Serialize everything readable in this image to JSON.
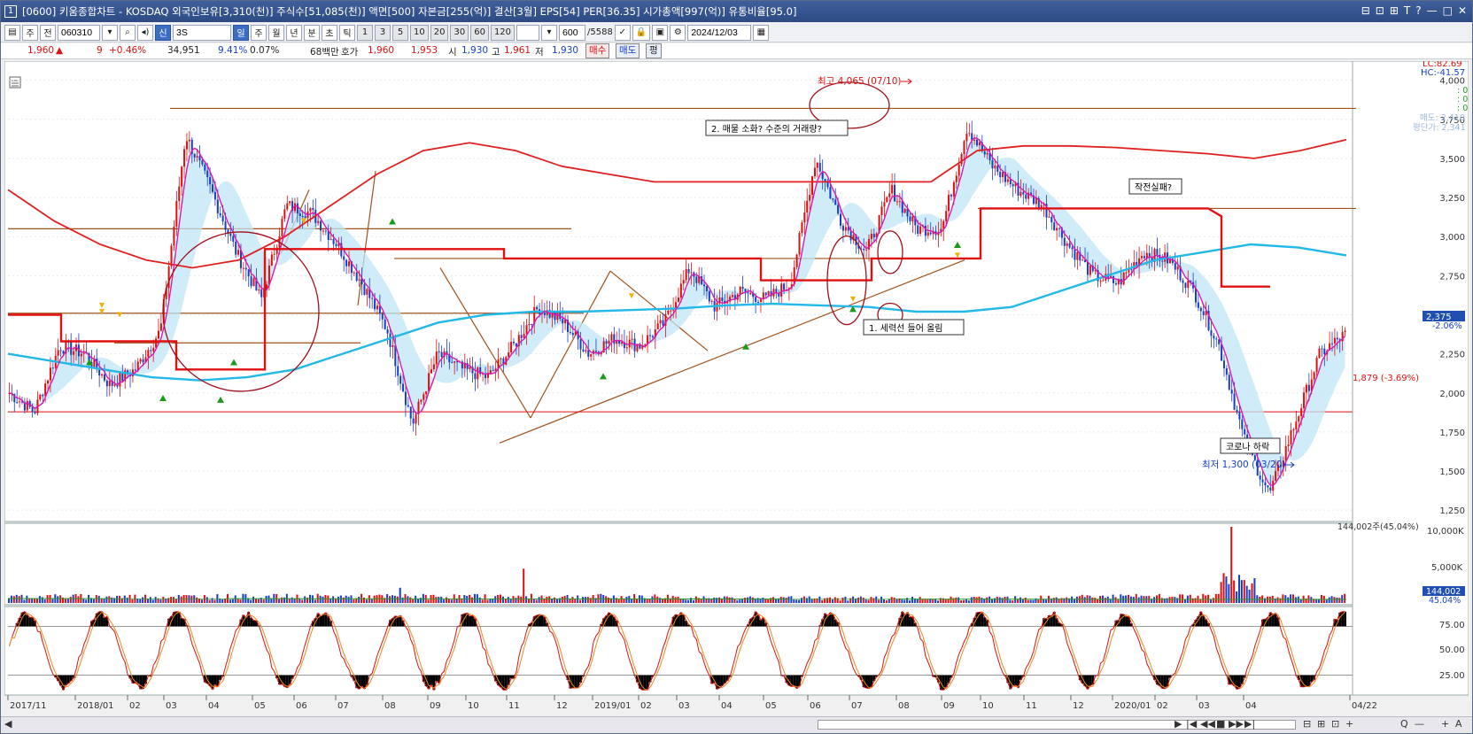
{
  "window": {
    "title": "[0600] 키움종합차트 - KOSDAQ 외국인보유[3,310(천)] 주식수[51,085(천)] 액면[500] 자본금[255(억)] 결산[3월] EPS[54] PER[36.35] 시가총액[997(억)] 유통비율[95.0]",
    "number": "1",
    "controls": [
      "⊟",
      "⊡",
      "⊞",
      "T",
      "?",
      "—",
      "□",
      "✕"
    ]
  },
  "toolbar": {
    "mode_btn": "주",
    "prev_btn": "전",
    "stock_code": "060310",
    "new_badge": "신",
    "stock_name": "3S",
    "period_buttons": [
      "일",
      "주",
      "월",
      "년",
      "분",
      "초",
      "틱"
    ],
    "active_period": "일",
    "interval_buttons": [
      "1",
      "3",
      "5",
      "10",
      "20",
      "30",
      "60",
      "120"
    ],
    "count": "600",
    "total": "/5588",
    "date": "2024/12/03"
  },
  "quote": {
    "price": "1,960",
    "arrow": "▲",
    "change": "9",
    "change_pct": "+0.46%",
    "volume": "34,951",
    "vol_ratio": "9.41%",
    "turnover": "0.07%",
    "amount": "68백만",
    "bid_label": "호가",
    "bid1": "1,960",
    "bid2": "1,953",
    "open_label": "시",
    "open": "1,930",
    "high_label": "고",
    "high": "1,961",
    "low_label": "저",
    "low": "1,930",
    "buy_btn": "매수",
    "sell_btn": "매도",
    "eval_btn": "평"
  },
  "scale": {
    "lc": "LC:82.69",
    "hc": "HC:-41.57",
    "price_ticks": [
      "4,000",
      "3,750",
      "3,500",
      "3,250",
      "3,000",
      "2,750",
      "2,500",
      "2,250",
      "2,000",
      "1,750",
      "1,500",
      "1,250"
    ],
    "current_price_box": "2,375",
    "current_pct": "-2.06%",
    "ref_line_label": "1,879 (-3.69%)",
    "zero_labels": [
      ": 0",
      ": 0",
      ": 0"
    ],
    "faded_labels": [
      "매도: 2,410",
      "평단가: 2,341"
    ],
    "volume_ticks": [
      "10,000K",
      "5,000K"
    ],
    "volume_header": "144,002주(45.04%)",
    "volume_box": "144,002",
    "volume_pct": "45.04%",
    "stoch_ticks": [
      "75.00",
      "50.00",
      "25.00"
    ]
  },
  "annotations": {
    "high_label": "최고 4,065 (07/10)",
    "low_label": "최저 1,300 (03/20)",
    "note1": "1. 세력선 들어 올림",
    "note2": "2. 매물 소화? 수준의 거래량?",
    "note3": "작전실패?",
    "note4": "코로나 하락"
  },
  "x_axis": {
    "labels": [
      "2017/11",
      "2018/01",
      "02",
      "03",
      "04",
      "05",
      "06",
      "07",
      "08",
      "09",
      "10",
      "11",
      "12",
      "2019/01",
      "02",
      "03",
      "04",
      "05",
      "06",
      "07",
      "08",
      "09",
      "10",
      "11",
      "12",
      "2020/01",
      "02",
      "03",
      "04",
      "04/22"
    ]
  },
  "scrollbar": {
    "buttons": [
      "◀",
      "▶",
      "|◀",
      "◀◀",
      "■",
      "▶▶",
      "▶|",
      "⊟",
      "⊞",
      "⊡",
      "+",
      "Q",
      "—",
      "+",
      "A"
    ]
  },
  "chart_data": {
    "type": "candlestick",
    "y_range": [
      1200,
      4100
    ],
    "high_marker": {
      "date": "2019/07/10",
      "value": 4065
    },
    "low_marker": {
      "date": "2020/03/20",
      "value": 1300
    },
    "reference_level": 1879,
    "close_series": [
      {
        "date": "2017/11",
        "value": 2000
      },
      {
        "date": "2017/12",
        "value": 1880
      },
      {
        "date": "2018/01",
        "value": 2300
      },
      {
        "date": "2018/02",
        "value": 2250
      },
      {
        "date": "2018/03",
        "value": 2050
      },
      {
        "date": "2018/04",
        "value": 2150
      },
      {
        "date": "2018/04b",
        "value": 2400
      },
      {
        "date": "2018/05",
        "value": 3650
      },
      {
        "date": "2018/05b",
        "value": 3300
      },
      {
        "date": "2018/06",
        "value": 2900
      },
      {
        "date": "2018/07",
        "value": 2600
      },
      {
        "date": "2018/07b",
        "value": 3200
      },
      {
        "date": "2018/08",
        "value": 3150
      },
      {
        "date": "2018/09",
        "value": 2950
      },
      {
        "date": "2018/09b",
        "value": 2700
      },
      {
        "date": "2018/10",
        "value": 2400
      },
      {
        "date": "2018/10b",
        "value": 1800
      },
      {
        "date": "2018/11",
        "value": 2250
      },
      {
        "date": "2018/12",
        "value": 2150
      },
      {
        "date": "2018/12b",
        "value": 2100
      },
      {
        "date": "2019/01",
        "value": 2300
      },
      {
        "date": "2019/01b",
        "value": 2550
      },
      {
        "date": "2019/02",
        "value": 2450
      },
      {
        "date": "2019/03",
        "value": 2250
      },
      {
        "date": "2019/03b",
        "value": 2350
      },
      {
        "date": "2019/04",
        "value": 2300
      },
      {
        "date": "2019/04b",
        "value": 2450
      },
      {
        "date": "2019/05",
        "value": 2800
      },
      {
        "date": "2019/05b",
        "value": 2550
      },
      {
        "date": "2019/06",
        "value": 2650
      },
      {
        "date": "2019/06b",
        "value": 2600
      },
      {
        "date": "2019/07",
        "value": 2700
      },
      {
        "date": "2019/07b",
        "value": 3500
      },
      {
        "date": "2019/07c",
        "value": 3100
      },
      {
        "date": "2019/08",
        "value": 2900
      },
      {
        "date": "2019/08b",
        "value": 3300
      },
      {
        "date": "2019/09",
        "value": 3050
      },
      {
        "date": "2019/09b",
        "value": 3050
      },
      {
        "date": "2019/10",
        "value": 3700
      },
      {
        "date": "2019/10b",
        "value": 3450
      },
      {
        "date": "2019/11",
        "value": 3300
      },
      {
        "date": "2019/11b",
        "value": 3200
      },
      {
        "date": "2019/12",
        "value": 2950
      },
      {
        "date": "2019/12b",
        "value": 2750
      },
      {
        "date": "2020/01",
        "value": 2700
      },
      {
        "date": "2020/01b",
        "value": 2900
      },
      {
        "date": "2020/02",
        "value": 2850
      },
      {
        "date": "2020/02b",
        "value": 2650
      },
      {
        "date": "2020/03",
        "value": 2300
      },
      {
        "date": "2020/03b",
        "value": 1700
      },
      {
        "date": "2020/03c",
        "value": 1350
      },
      {
        "date": "2020/04",
        "value": 1800
      },
      {
        "date": "2020/04b",
        "value": 2250
      },
      {
        "date": "2020/04c",
        "value": 2375
      }
    ],
    "ma_long_cyan": [
      2250,
      2200,
      2150,
      2100,
      2080,
      2100,
      2150,
      2250,
      2350,
      2450,
      2500,
      2520,
      2520,
      2530,
      2540,
      2560,
      2570,
      2560,
      2550,
      2520,
      2520,
      2550,
      2650,
      2750,
      2850,
      2900,
      2950,
      2930,
      2880
    ],
    "ma_long_red": [
      3300,
      3100,
      2950,
      2850,
      2800,
      2850,
      3000,
      3200,
      3400,
      3550,
      3600,
      3550,
      3450,
      3400,
      3350,
      3350,
      3350,
      3350,
      3350,
      3350,
      3350,
      3550,
      3580,
      3580,
      3570,
      3550,
      3530,
      3500,
      3550,
      3620
    ]
  }
}
